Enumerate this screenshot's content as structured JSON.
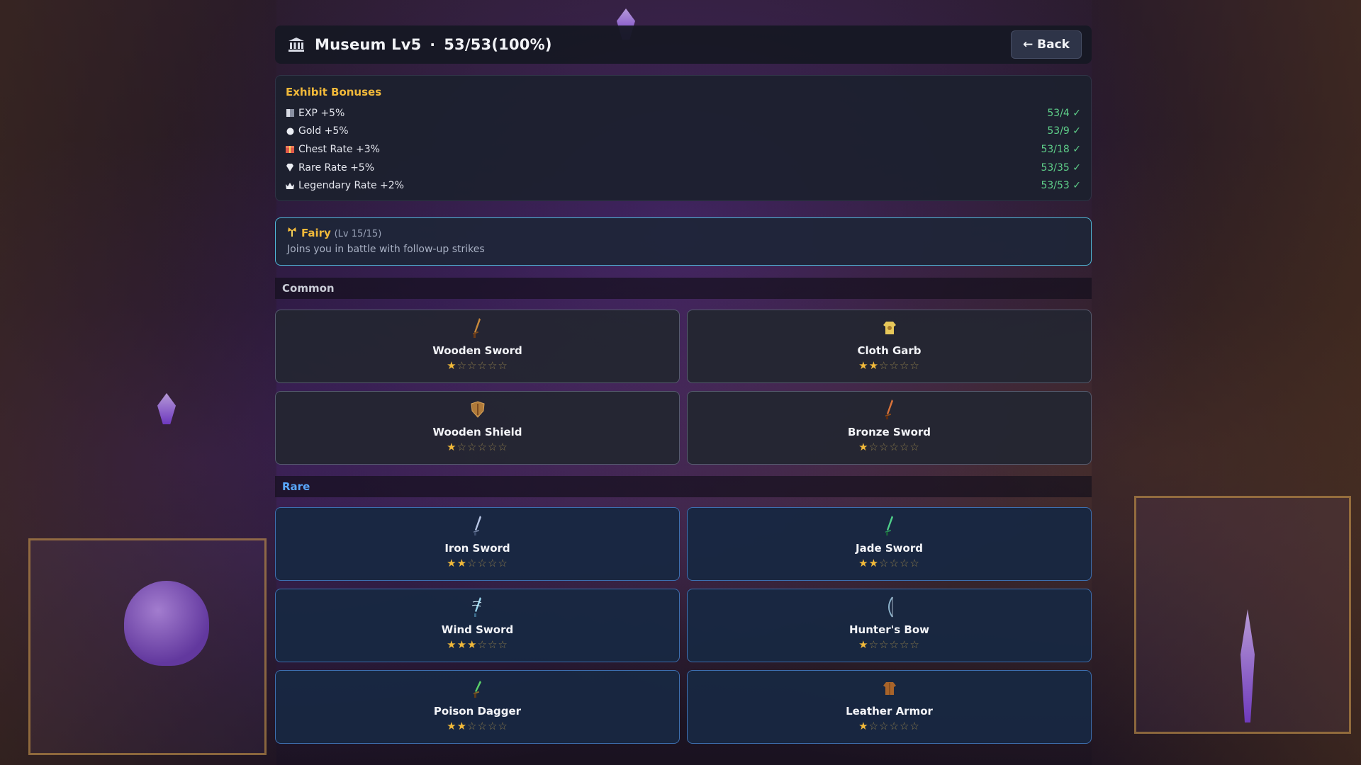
{
  "header": {
    "title": "Museum Lv5",
    "separator": "·",
    "progress": "53/53(100%)",
    "back_label": "← Back"
  },
  "bonuses": {
    "heading": "Exhibit Bonuses",
    "items": [
      {
        "label": "EXP +5%",
        "count": "53/4 ✓",
        "icon": "exp-icon",
        "complete": true
      },
      {
        "label": "Gold +5%",
        "count": "53/9 ✓",
        "icon": "gold-icon",
        "complete": true
      },
      {
        "label": "Chest Rate +3%",
        "count": "53/18 ✓",
        "icon": "chest-icon",
        "complete": true
      },
      {
        "label": "Rare Rate +5%",
        "count": "53/35 ✓",
        "icon": "gem-icon",
        "complete": true
      },
      {
        "label": "Legendary Rate +2%",
        "count": "53/53 ✓",
        "icon": "crown-icon",
        "complete": true
      }
    ]
  },
  "fairy": {
    "name": "Fairy",
    "level": "(Lv 15/15)",
    "description": "Joins you in battle with follow-up strikes"
  },
  "sections": [
    {
      "label": "Common",
      "label_color": "#c9ccd6",
      "items": [
        {
          "name": "Wooden Sword",
          "stars": 1,
          "max_stars": 6,
          "icon": "wooden-sword-icon"
        },
        {
          "name": "Cloth Garb",
          "stars": 2,
          "max_stars": 6,
          "icon": "cloth-garb-icon"
        },
        {
          "name": "Wooden Shield",
          "stars": 1,
          "max_stars": 6,
          "icon": "wooden-shield-icon"
        },
        {
          "name": "Bronze Sword",
          "stars": 1,
          "max_stars": 6,
          "icon": "bronze-sword-icon"
        }
      ]
    },
    {
      "label": "Rare",
      "label_color": "#5aa8ff",
      "items": [
        {
          "name": "Iron Sword",
          "stars": 2,
          "max_stars": 6,
          "icon": "iron-sword-icon"
        },
        {
          "name": "Jade Sword",
          "stars": 2,
          "max_stars": 6,
          "icon": "jade-sword-icon"
        },
        {
          "name": "Wind Sword",
          "stars": 3,
          "max_stars": 6,
          "icon": "wind-sword-icon"
        },
        {
          "name": "Hunter's Bow",
          "stars": 1,
          "max_stars": 6,
          "icon": "hunters-bow-icon"
        },
        {
          "name": "Poison Dagger",
          "stars": 2,
          "max_stars": 6,
          "icon": "poison-dagger-icon"
        },
        {
          "name": "Leather Armor",
          "stars": 1,
          "max_stars": 6,
          "icon": "leather-armor-icon"
        }
      ]
    }
  ],
  "colors": {
    "accent": "#f1b93a",
    "complete": "#5fd08a",
    "rare": "#5aa8ff",
    "fairy_border": "#4fb8d8"
  }
}
